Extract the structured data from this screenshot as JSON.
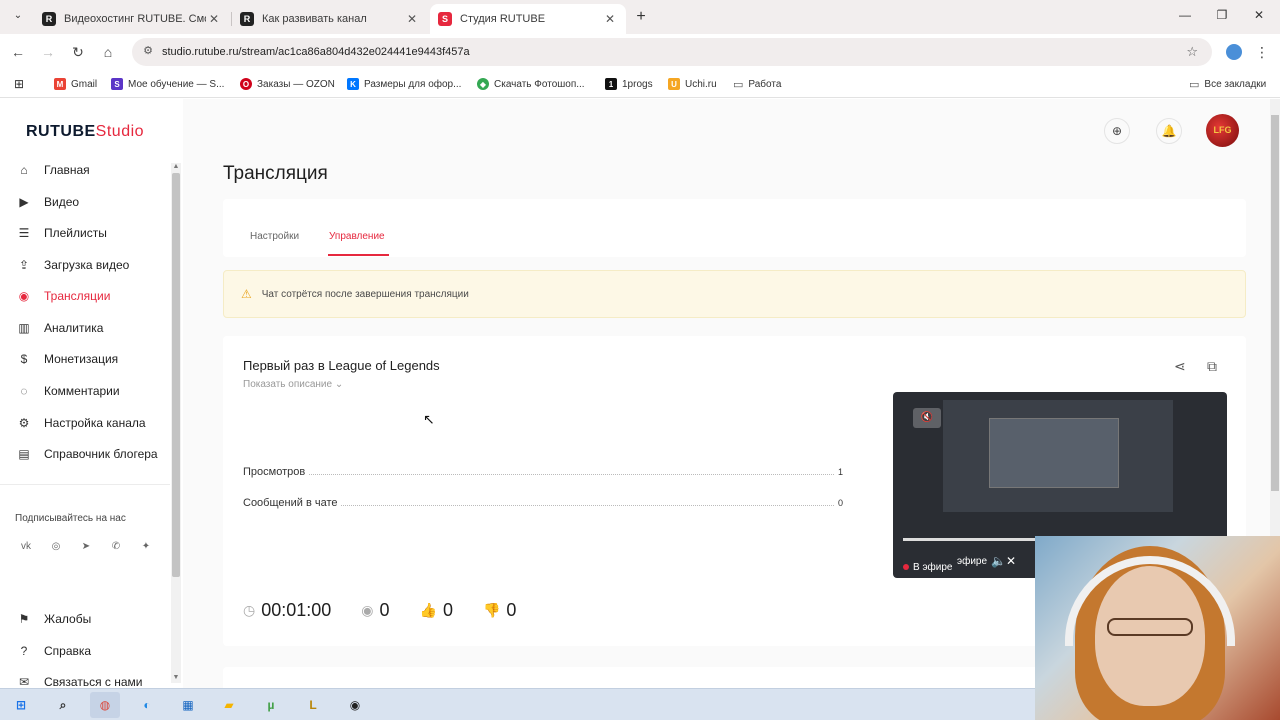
{
  "browser": {
    "tabs": [
      {
        "label": "Видеохостинг RUTUBE. Смотр",
        "active": false
      },
      {
        "label": "Как развивать канал",
        "active": false
      },
      {
        "label": "Студия RUTUBE",
        "active": true
      }
    ],
    "url": "studio.rutube.ru/stream/ac1ca86a804d432e024441e9443f457a",
    "bookmarks": [
      "Gmail",
      "Мое обучение — S...",
      "Заказы — OZON",
      "Размеры для офор...",
      "Скачать Фотошоп...",
      "1progs",
      "Uchi.ru",
      "Работа"
    ],
    "all_bookmarks": "Все закладки"
  },
  "header": {
    "logo_main": "RUTUBE",
    "logo_sub": "Studio"
  },
  "sidebar": {
    "items": [
      {
        "label": "Главная",
        "icon": "home-icon",
        "active": false
      },
      {
        "label": "Видео",
        "icon": "video-icon",
        "active": false
      },
      {
        "label": "Плейлисты",
        "icon": "playlist-icon",
        "active": false
      },
      {
        "label": "Загрузка видео",
        "icon": "upload-icon",
        "active": false
      },
      {
        "label": "Трансляции",
        "icon": "broadcast-icon",
        "active": true
      },
      {
        "label": "Аналитика",
        "icon": "analytics-icon",
        "active": false
      },
      {
        "label": "Монетизация",
        "icon": "money-icon",
        "active": false
      },
      {
        "label": "Комментарии",
        "icon": "comments-icon",
        "active": false
      },
      {
        "label": "Настройка канала",
        "icon": "settings-icon",
        "active": false
      },
      {
        "label": "Справочник блогера",
        "icon": "book-icon",
        "active": false
      }
    ],
    "subscribe_label": "Подписывайтесь на нас",
    "social": [
      "vk-icon",
      "ok-icon",
      "telegram-icon",
      "viber-icon",
      "zen-icon"
    ],
    "bottom_items": [
      {
        "label": "Жалобы",
        "icon": "flag-icon"
      },
      {
        "label": "Справка",
        "icon": "help-icon"
      },
      {
        "label": "Связаться с нами",
        "icon": "mail-icon"
      }
    ]
  },
  "main": {
    "page_title": "Трансляция",
    "tabs": [
      {
        "label": "Настройки",
        "active": false
      },
      {
        "label": "Управление",
        "active": true
      }
    ],
    "alert": "Чат сотрётся после завершения трансляции",
    "stream": {
      "title": "Первый раз в League of Legends",
      "show_description": "Показать описание",
      "stats": [
        {
          "label": "Просмотров",
          "value": "1"
        },
        {
          "label": "Сообщений в чате",
          "value": "0"
        }
      ],
      "duration": "00:01:00",
      "viewers": "0",
      "likes": "0",
      "dislikes": "0",
      "player": {
        "live_label": "В эфире",
        "live_label_overlay": "эфире"
      }
    }
  },
  "colors": {
    "accent": "#e6283e",
    "alert_bg": "#fdf8e6"
  }
}
